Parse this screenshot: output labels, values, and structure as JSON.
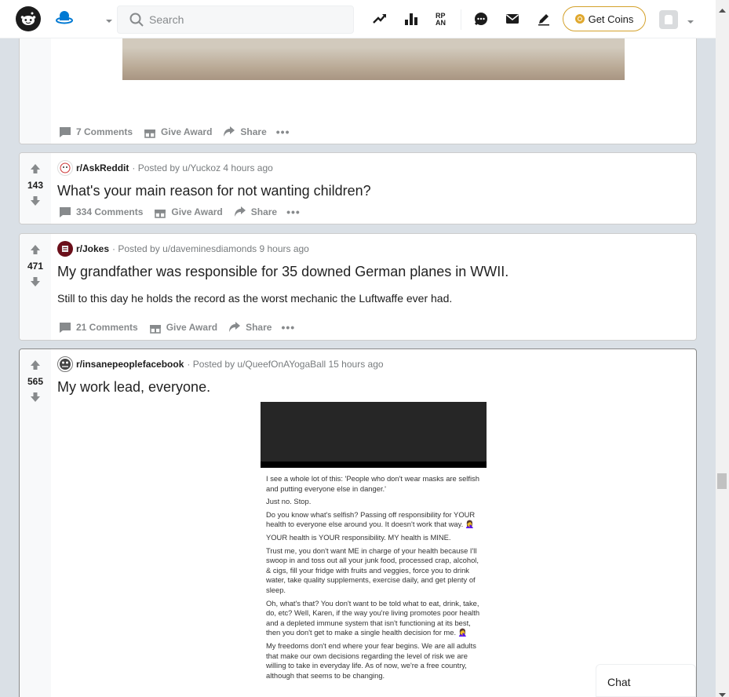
{
  "header": {
    "search_placeholder": "Search",
    "get_coins": "Get Coins",
    "icons": [
      "reddit-logo",
      "home-icon",
      "popular-icon",
      "leaderboard-icon",
      "rpan-icon",
      "chat-icon",
      "mail-icon",
      "create-post-icon",
      "coin-icon"
    ]
  },
  "posts": [
    {
      "comments": "7 Comments",
      "award": "Give Award",
      "share": "Share",
      "more": "•••"
    },
    {
      "score": "143",
      "subreddit": "r/AskReddit",
      "posted_by": "· Posted by u/Yuckoz 4 hours ago",
      "title": "What's your main reason for not wanting children?",
      "comments": "334 Comments",
      "award": "Give Award",
      "share": "Share",
      "more": "•••"
    },
    {
      "score": "471",
      "subreddit": "r/Jokes",
      "posted_by": "· Posted by u/daveminesdiamonds 9 hours ago",
      "title": "My grandfather was responsible for 35 downed German planes in WWII.",
      "body": "Still to this day he holds the record as the worst mechanic the Luftwaffe ever had.",
      "comments": "21 Comments",
      "award": "Give Award",
      "share": "Share",
      "more": "•••"
    },
    {
      "score": "565",
      "subreddit": "r/insanepeoplefacebook",
      "posted_by": "· Posted by u/QueefOnAYogaBall 15 hours ago",
      "title": "My work lead, everyone.",
      "image_text": [
        "I see a whole lot of this: 'People who don't wear masks are selfish and putting everyone else in danger.'",
        "Just no. Stop.",
        "Do you know what's selfish? Passing off responsibility for YOUR health to everyone else around you. It doesn't work that way. 🤦‍♀️",
        "YOUR health is YOUR responsibility. MY health is MINE.",
        "Trust me, you don't want ME in charge of your health because I'll swoop in and toss out all your junk food, processed crap, alcohol, & cigs, fill your fridge with fruits and veggies, force you to drink water, take quality supplements, exercise daily, and get plenty of sleep.",
        "Oh, what's that? You don't want to be told what to eat, drink, take, do, etc? Well, Karen, if the way you're living promotes poor health and a depleted immune system that isn't functioning at its best, then you don't get to make a single health decision for me. 🤦‍♀️",
        "My freedoms don't end where your fear begins. We are all adults that make our own decisions regarding the level of risk we are willing to take in everyday life. As of now, we're a free country, although that seems to be changing."
      ]
    }
  ],
  "chat": "Chat"
}
